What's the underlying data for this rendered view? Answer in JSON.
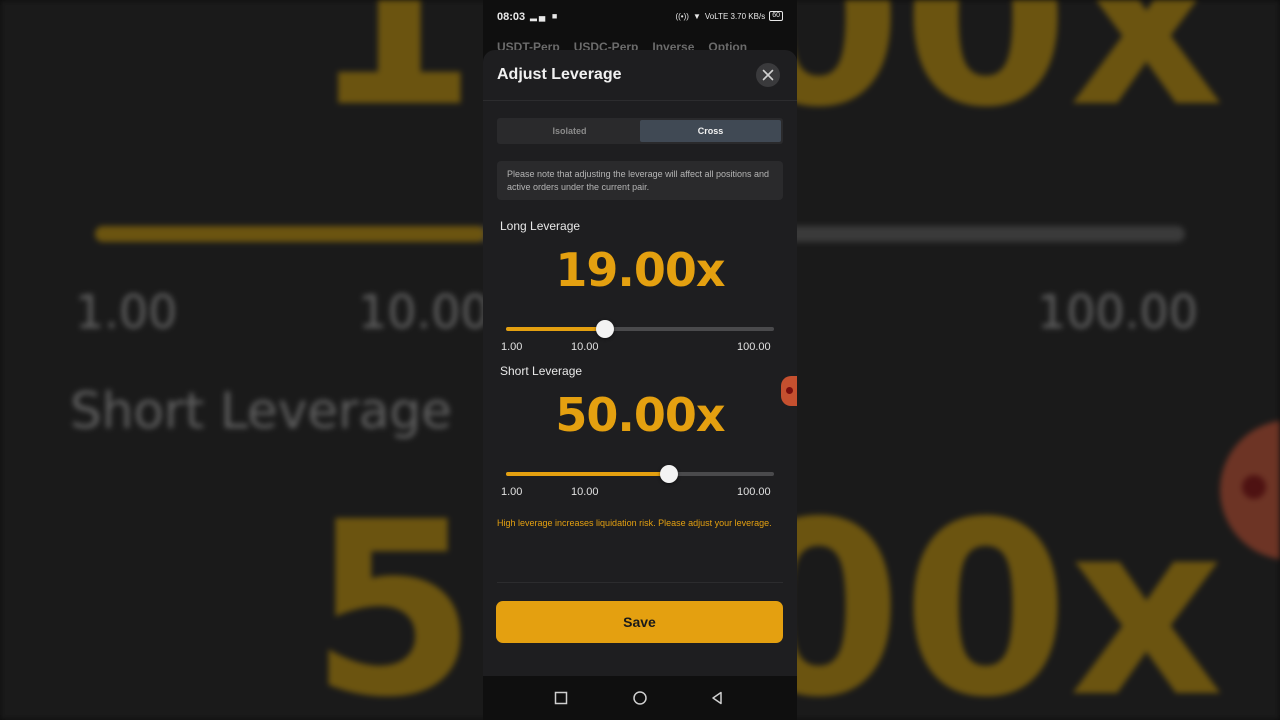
{
  "background": {
    "top_value": "19.00x",
    "bottom_value": "50.00x",
    "tick_min": "1.00",
    "tick_mid": "10.00",
    "tick_max": "100.00",
    "short_label": "Short Leverage"
  },
  "status_bar": {
    "time": "08:03",
    "left_icons": "signal-icon video-record-icon",
    "right_text": "VoLTE 3.70 KB/s",
    "battery": "60"
  },
  "behind_tabs": [
    "USDT-Perp",
    "USDC-Perp",
    "Inverse",
    "Option"
  ],
  "sheet": {
    "title": "Adjust Leverage",
    "modes": {
      "isolated": "Isolated",
      "cross": "Cross",
      "selected": "Cross"
    },
    "note": "Please note that adjusting the leverage will affect all positions and active orders under the current pair.",
    "long": {
      "label": "Long Leverage",
      "value": "19.00x",
      "slider_position": 0.37,
      "tick_min": "1.00",
      "tick_mid": "10.00",
      "tick_max": "100.00"
    },
    "short": {
      "label": "Short Leverage",
      "value": "50.00x",
      "slider_position": 0.61,
      "tick_min": "1.00",
      "tick_mid": "10.00",
      "tick_max": "100.00"
    },
    "warning": "High leverage increases liquidation risk. Please adjust your leverage.",
    "save_label": "Save"
  },
  "colors": {
    "accent": "#e4a010",
    "sheet_bg": "#1e1e20",
    "active_mode_bg": "#404954"
  },
  "nav_icons": [
    "recents-square-icon",
    "home-circle-icon",
    "back-triangle-icon"
  ]
}
